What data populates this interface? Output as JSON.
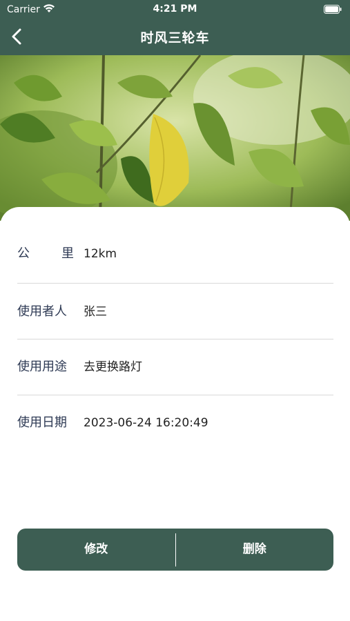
{
  "status_bar": {
    "carrier": "Carrier",
    "time": "4:21 PM"
  },
  "nav": {
    "title": "时风三轮车",
    "back_icon": "chevron-left-icon"
  },
  "details": [
    {
      "label": "公里",
      "value": "12km"
    },
    {
      "label": "使用者人",
      "value": "张三"
    },
    {
      "label": "使用用途",
      "value": "去更换路灯"
    },
    {
      "label": "使用日期",
      "value": "2023-06-24 16:20:49"
    }
  ],
  "actions": {
    "edit_label": "修改",
    "delete_label": "删除"
  },
  "colors": {
    "primary": "#3d5e53",
    "label_text": "#2e3a54"
  }
}
